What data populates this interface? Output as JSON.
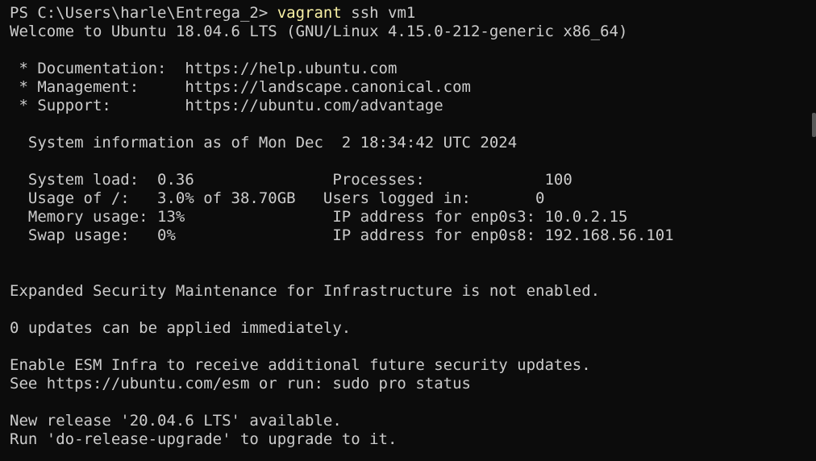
{
  "terminal": {
    "prompt": "PS C:\\Users\\harle\\Entrega_2> ",
    "command_name": "vagrant",
    "command_args": " ssh vm1",
    "lines": [
      "Welcome to Ubuntu 18.04.6 LTS (GNU/Linux 4.15.0-212-generic x86_64)",
      "",
      " * Documentation:  https://help.ubuntu.com",
      " * Management:     https://landscape.canonical.com",
      " * Support:        https://ubuntu.com/advantage",
      "",
      "  System information as of Mon Dec  2 18:34:42 UTC 2024",
      "",
      "  System load:  0.36               Processes:             100",
      "  Usage of /:   3.0% of 38.70GB   Users logged in:       0",
      "  Memory usage: 13%                IP address for enp0s3: 10.0.2.15",
      "  Swap usage:   0%                 IP address for enp0s8: 192.168.56.101",
      "",
      "",
      "Expanded Security Maintenance for Infrastructure is not enabled.",
      "",
      "0 updates can be applied immediately.",
      "",
      "Enable ESM Infra to receive additional future security updates.",
      "See https://ubuntu.com/esm or run: sudo pro status",
      "",
      "New release '20.04.6 LTS' available.",
      "Run 'do-release-upgrade' to upgrade to it."
    ]
  },
  "colors": {
    "background": "#0c0c0c",
    "text": "#cccccc",
    "command_highlight": "#f9f1a5"
  }
}
